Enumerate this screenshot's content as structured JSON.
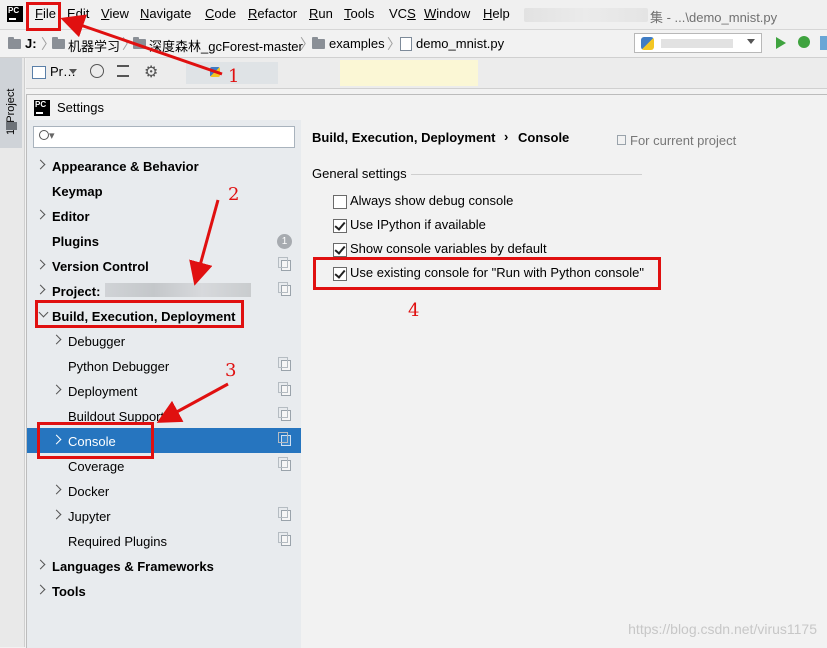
{
  "menubar": {
    "items": [
      "File",
      "Edit",
      "View",
      "Navigate",
      "Code",
      "Refactor",
      "Run",
      "Tools",
      "VCS",
      "Window",
      "Help"
    ],
    "mnemonic": [
      "F",
      "E",
      "V",
      "N",
      "C",
      "R",
      "R",
      "T",
      "S",
      "W",
      "H"
    ],
    "title_suffix": "集 - ...\\demo_mnist.py"
  },
  "navbar": {
    "drive": "J:",
    "crumbs": [
      "机器学习",
      "深度森林_gcForest-master",
      "examples",
      "demo_mnist.py"
    ]
  },
  "toolrow": {
    "project_label": "Pr…"
  },
  "side_panel": {
    "tab_label": "1: Project"
  },
  "dialog": {
    "title": "Settings",
    "search_placeholder": "Q•",
    "tree": [
      {
        "label": "Appearance & Behavior",
        "bold": true
      },
      {
        "label": "Keymap",
        "bold": true
      },
      {
        "label": "Editor",
        "bold": true
      },
      {
        "label": "Plugins",
        "bold": true,
        "badge": "1"
      },
      {
        "label": "Version Control",
        "bold": true
      },
      {
        "label": "Project:",
        "bold": true
      },
      {
        "label": "Build, Execution, Deployment",
        "bold": true
      },
      {
        "label": "Debugger"
      },
      {
        "label": "Python Debugger"
      },
      {
        "label": "Deployment"
      },
      {
        "label": "Buildout Support"
      },
      {
        "label": "Console"
      },
      {
        "label": "Coverage"
      },
      {
        "label": "Docker"
      },
      {
        "label": "Jupyter"
      },
      {
        "label": "Required Plugins"
      },
      {
        "label": "Languages & Frameworks",
        "bold": true
      },
      {
        "label": "Tools",
        "bold": true
      }
    ],
    "breadcrumb": [
      "Build, Execution, Deployment",
      "Console"
    ],
    "breadcrumb_sep": "›",
    "for_current_project": "For current project",
    "section_title": "General settings",
    "options": [
      {
        "label": "Always show debug console",
        "checked": false
      },
      {
        "label": "Use IPython if available",
        "checked": true
      },
      {
        "label": "Show console variables by default",
        "checked": true
      },
      {
        "label": "Use existing console for \"Run with Python console\"",
        "checked": true
      }
    ]
  },
  "annotations": {
    "numbers": [
      "1",
      "2",
      "3",
      "4"
    ],
    "color": "#e01010"
  },
  "colors": {
    "selection": "#2675bf",
    "accent_red": "#e01010"
  },
  "watermark": "https://blog.csdn.net/virus1175"
}
